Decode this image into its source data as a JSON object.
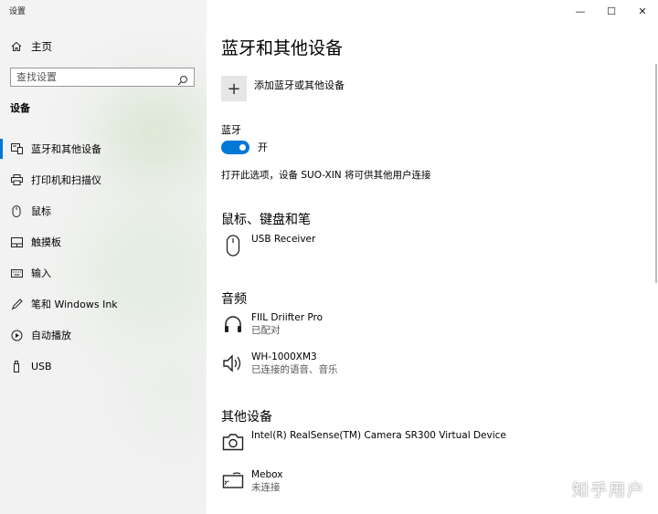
{
  "window": {
    "title": "设置",
    "controls": [
      "—",
      "☐",
      "✕"
    ]
  },
  "sidebar": {
    "home_label": "主页",
    "search_placeholder": "查找设置",
    "section_label": "设备",
    "items": [
      {
        "label": "蓝牙和其他设备",
        "icon": "bluetooth-devices-icon",
        "active": true
      },
      {
        "label": "打印机和扫描仪",
        "icon": "printer-icon",
        "active": false
      },
      {
        "label": "鼠标",
        "icon": "mouse-icon",
        "active": false
      },
      {
        "label": "触摸板",
        "icon": "touchpad-icon",
        "active": false
      },
      {
        "label": "输入",
        "icon": "keyboard-icon",
        "active": false
      },
      {
        "label": "笔和 Windows Ink",
        "icon": "pen-icon",
        "active": false
      },
      {
        "label": "自动播放",
        "icon": "autoplay-icon",
        "active": false
      },
      {
        "label": "USB",
        "icon": "usb-icon",
        "active": false
      }
    ]
  },
  "main": {
    "title": "蓝牙和其他设备",
    "add_device_label": "添加蓝牙或其他设备",
    "bluetooth": {
      "label": "蓝牙",
      "state": "开",
      "enabled": true,
      "description": "打开此选项，设备 SUO-XIN 将可供其他用户连接"
    },
    "groups": [
      {
        "title": "鼠标、键盘和笔",
        "devices": [
          {
            "name": "USB Receiver",
            "status": "",
            "icon": "mouse-icon"
          }
        ]
      },
      {
        "title": "音频",
        "devices": [
          {
            "name": "FIIL Driifter Pro",
            "status": "已配对",
            "icon": "headphones-icon"
          },
          {
            "name": "WH-1000XM3",
            "status": "已连接的语音、音乐",
            "icon": "speaker-icon"
          }
        ]
      },
      {
        "title": "其他设备",
        "devices": [
          {
            "name": "Intel(R) RealSense(TM) Camera SR300 Virtual Device",
            "status": "",
            "icon": "camera-icon"
          },
          {
            "name": "Mebox",
            "status": "未连接",
            "icon": "wireless-display-icon"
          }
        ]
      }
    ]
  },
  "watermark": "知乎用户",
  "colors": {
    "accent": "#0078d7",
    "sidebar_bg": "#f2f2f2",
    "add_button_bg": "#e6e6e6"
  }
}
